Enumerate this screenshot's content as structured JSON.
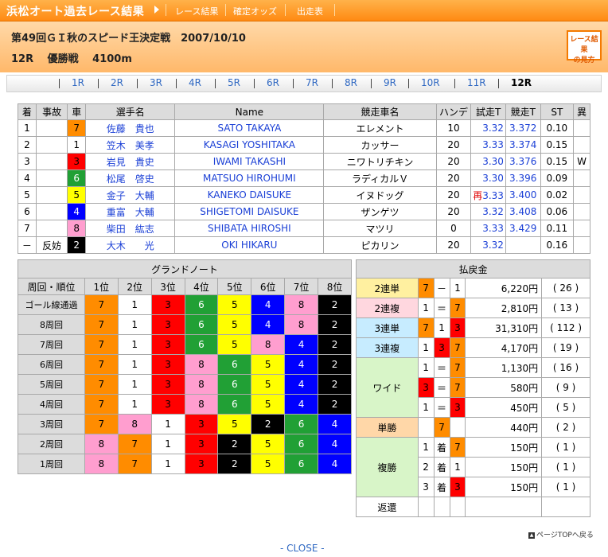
{
  "header": {
    "site_title": "浜松オート過去レース結果",
    "nav": [
      "レース結果",
      "確定オッズ",
      "出走表"
    ],
    "race_title": "第49回ＧＩ秋のスピード王決定戦　2007/10/10",
    "race_sub": "12R　 優勝戦　 4100m",
    "guide_button": [
      "レース結果",
      "の見方"
    ]
  },
  "rounds": [
    "1R",
    "2R",
    "3R",
    "4R",
    "5R",
    "6R",
    "7R",
    "8R",
    "9R",
    "10R",
    "11R",
    "12R"
  ],
  "current_round": "12R",
  "results": {
    "columns": [
      "着",
      "事故",
      "車",
      "選手名",
      "Name",
      "競走車名",
      "ハンデ",
      "試走T",
      "競走T",
      "ST",
      "異"
    ],
    "rows": [
      {
        "rank": "1",
        "accident": "",
        "car": "7",
        "name": "佐藤　貴也",
        "roman": "SATO TAKAYA",
        "machine": "エレメント",
        "handicap": "10",
        "trial": "3.32",
        "trial_mark": "",
        "race": "3.372",
        "st": "0.10",
        "abn": ""
      },
      {
        "rank": "2",
        "accident": "",
        "car": "1",
        "name": "笠木　美孝",
        "roman": "KASAGI YOSHITAKA",
        "machine": "カッサー",
        "handicap": "20",
        "trial": "3.33",
        "trial_mark": "",
        "race": "3.374",
        "st": "0.15",
        "abn": ""
      },
      {
        "rank": "3",
        "accident": "",
        "car": "3",
        "name": "岩見　貴史",
        "roman": "IWAMI TAKASHI",
        "machine": "ニワトリチキン",
        "handicap": "20",
        "trial": "3.30",
        "trial_mark": "",
        "race": "3.376",
        "st": "0.15",
        "abn": "W"
      },
      {
        "rank": "4",
        "accident": "",
        "car": "6",
        "name": "松尾　啓史",
        "roman": "MATSUO HIROHUMI",
        "machine": "ラディカルＶ",
        "handicap": "20",
        "trial": "3.30",
        "trial_mark": "",
        "race": "3.396",
        "st": "0.09",
        "abn": ""
      },
      {
        "rank": "5",
        "accident": "",
        "car": "5",
        "name": "金子　大輔",
        "roman": "KANEKO DAISUKE",
        "machine": "イヌドッグ",
        "handicap": "20",
        "trial": "3.33",
        "trial_mark": "再",
        "race": "3.400",
        "st": "0.02",
        "abn": ""
      },
      {
        "rank": "6",
        "accident": "",
        "car": "4",
        "name": "重富　大輔",
        "roman": "SHIGETOMI DAISUKE",
        "machine": "ザンゲツ",
        "handicap": "20",
        "trial": "3.32",
        "trial_mark": "",
        "race": "3.408",
        "st": "0.06",
        "abn": ""
      },
      {
        "rank": "7",
        "accident": "",
        "car": "8",
        "name": "柴田　紘志",
        "roman": "SHIBATA HIROSHI",
        "machine": "マツリ",
        "handicap": "0",
        "trial": "3.33",
        "trial_mark": "",
        "race": "3.429",
        "st": "0.11",
        "abn": ""
      },
      {
        "rank": "－",
        "accident": "反妨",
        "car": "2",
        "name": "大木　　光",
        "roman": "OKI HIKARU",
        "machine": "ピカリン",
        "handicap": "20",
        "trial": "3.32",
        "trial_mark": "",
        "race": "",
        "st": "0.16",
        "abn": ""
      }
    ]
  },
  "grand_note": {
    "title": "グランドノート",
    "columns": [
      "周回・順位",
      "1位",
      "2位",
      "3位",
      "4位",
      "5位",
      "6位",
      "7位",
      "8位"
    ],
    "rows": [
      {
        "lap": "ゴール線通過",
        "order": [
          "7",
          "1",
          "3",
          "6",
          "5",
          "4",
          "8",
          "2"
        ]
      },
      {
        "lap": "8周回",
        "order": [
          "7",
          "1",
          "3",
          "6",
          "5",
          "4",
          "8",
          "2"
        ]
      },
      {
        "lap": "7周回",
        "order": [
          "7",
          "1",
          "3",
          "6",
          "5",
          "8",
          "4",
          "2"
        ]
      },
      {
        "lap": "6周回",
        "order": [
          "7",
          "1",
          "3",
          "8",
          "6",
          "5",
          "4",
          "2"
        ]
      },
      {
        "lap": "5周回",
        "order": [
          "7",
          "1",
          "3",
          "8",
          "6",
          "5",
          "4",
          "2"
        ]
      },
      {
        "lap": "4周回",
        "order": [
          "7",
          "1",
          "3",
          "8",
          "6",
          "5",
          "4",
          "2"
        ]
      },
      {
        "lap": "3周回",
        "order": [
          "7",
          "8",
          "1",
          "3",
          "5",
          "2",
          "6",
          "4"
        ]
      },
      {
        "lap": "2周回",
        "order": [
          "8",
          "7",
          "1",
          "3",
          "2",
          "5",
          "6",
          "4"
        ]
      },
      {
        "lap": "1周回",
        "order": [
          "8",
          "7",
          "1",
          "3",
          "2",
          "5",
          "6",
          "4"
        ]
      }
    ]
  },
  "payout": {
    "title": "払戻金",
    "rows": [
      {
        "kind": "2連単",
        "kcls": "k-2t",
        "span": 1,
        "c": [
          "7",
          "－",
          "1"
        ],
        "amount": "6,220円",
        "pop": "( 26 )"
      },
      {
        "kind": "2連複",
        "kcls": "k-2f",
        "span": 1,
        "c": [
          "1",
          "＝",
          "7"
        ],
        "amount": "2,810円",
        "pop": "( 13 )"
      },
      {
        "kind": "3連単",
        "kcls": "k-3t",
        "span": 1,
        "c": [
          "7",
          "1",
          "3"
        ],
        "amount": "31,310円",
        "pop": "( 112 )"
      },
      {
        "kind": "3連複",
        "kcls": "k-3f",
        "span": 1,
        "c": [
          "1",
          "3",
          "7"
        ],
        "amount": "4,170円",
        "pop": "( 19 )"
      },
      {
        "kind": "ワイド",
        "kcls": "k-wide",
        "span": 3,
        "c": [
          "1",
          "＝",
          "7"
        ],
        "amount": "1,130円",
        "pop": "( 16 )"
      },
      {
        "kind": "",
        "kcls": "",
        "span": 0,
        "c": [
          "3",
          "＝",
          "7"
        ],
        "amount": "580円",
        "pop": "( 9 )"
      },
      {
        "kind": "",
        "kcls": "",
        "span": 0,
        "c": [
          "1",
          "＝",
          "3"
        ],
        "amount": "450円",
        "pop": "( 5 )"
      },
      {
        "kind": "単勝",
        "kcls": "k-tan",
        "span": 1,
        "c": [
          "",
          "7",
          ""
        ],
        "amount": "440円",
        "pop": "( 2 )"
      },
      {
        "kind": "複勝",
        "kcls": "k-fuku",
        "span": 3,
        "c": [
          "1",
          "着",
          "7"
        ],
        "amount": "150円",
        "pop": "( 1 )"
      },
      {
        "kind": "",
        "kcls": "",
        "span": 0,
        "c": [
          "2",
          "着",
          "1"
        ],
        "amount": "150円",
        "pop": "( 1 )"
      },
      {
        "kind": "",
        "kcls": "",
        "span": 0,
        "c": [
          "3",
          "着",
          "3"
        ],
        "amount": "150円",
        "pop": "( 1 )"
      },
      {
        "kind": "返還",
        "kcls": "k-hen",
        "span": 1,
        "c": [
          "",
          "",
          ""
        ],
        "amount": "",
        "pop": ""
      }
    ]
  },
  "footer": {
    "pagetop": "ページTOPへ戻る",
    "close": "- CLOSE -"
  },
  "car_colors": {
    "1": "#ffffff",
    "2": "#000000",
    "3": "#ff0000",
    "4": "#0000ff",
    "5": "#ffff00",
    "6": "#21a035",
    "7": "#ff8c00",
    "8": "#ff9ecf"
  }
}
